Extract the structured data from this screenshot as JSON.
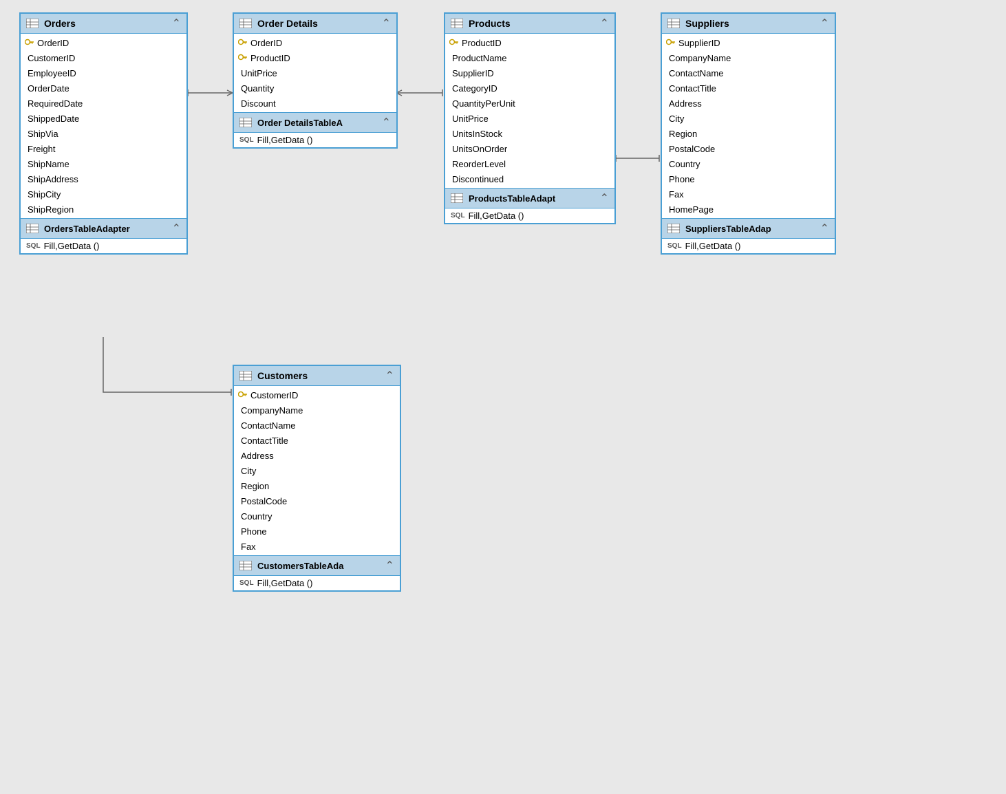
{
  "tables": {
    "orders": {
      "title": "Orders",
      "fields": [
        {
          "name": "OrderID",
          "key": true
        },
        {
          "name": "CustomerID",
          "key": false
        },
        {
          "name": "EmployeeID",
          "key": false
        },
        {
          "name": "OrderDate",
          "key": false
        },
        {
          "name": "RequiredDate",
          "key": false
        },
        {
          "name": "ShippedDate",
          "key": false
        },
        {
          "name": "ShipVia",
          "key": false
        },
        {
          "name": "Freight",
          "key": false
        },
        {
          "name": "ShipName",
          "key": false
        },
        {
          "name": "ShipAddress",
          "key": false
        },
        {
          "name": "ShipCity",
          "key": false
        },
        {
          "name": "ShipRegion",
          "key": false
        }
      ],
      "adapter": "OrdersTableAdapter",
      "method": "Fill,GetData ()"
    },
    "orderDetails": {
      "title": "Order Details",
      "fields": [
        {
          "name": "OrderID",
          "key": true
        },
        {
          "name": "ProductID",
          "key": true
        },
        {
          "name": "UnitPrice",
          "key": false
        },
        {
          "name": "Quantity",
          "key": false
        },
        {
          "name": "Discount",
          "key": false
        }
      ],
      "adapter": "Order DetailsTableA",
      "method": "Fill,GetData ()"
    },
    "products": {
      "title": "Products",
      "fields": [
        {
          "name": "ProductID",
          "key": true
        },
        {
          "name": "ProductName",
          "key": false
        },
        {
          "name": "SupplierID",
          "key": false
        },
        {
          "name": "CategoryID",
          "key": false
        },
        {
          "name": "QuantityPerUnit",
          "key": false
        },
        {
          "name": "UnitPrice",
          "key": false
        },
        {
          "name": "UnitsInStock",
          "key": false
        },
        {
          "name": "UnitsOnOrder",
          "key": false
        },
        {
          "name": "ReorderLevel",
          "key": false
        },
        {
          "name": "Discontinued",
          "key": false
        }
      ],
      "adapter": "ProductsTableAdapt",
      "method": "Fill,GetData ()"
    },
    "suppliers": {
      "title": "Suppliers",
      "fields": [
        {
          "name": "SupplierID",
          "key": true
        },
        {
          "name": "CompanyName",
          "key": false
        },
        {
          "name": "ContactName",
          "key": false
        },
        {
          "name": "ContactTitle",
          "key": false
        },
        {
          "name": "Address",
          "key": false
        },
        {
          "name": "City",
          "key": false
        },
        {
          "name": "Region",
          "key": false
        },
        {
          "name": "PostalCode",
          "key": false
        },
        {
          "name": "Country",
          "key": false
        },
        {
          "name": "Phone",
          "key": false
        },
        {
          "name": "Fax",
          "key": false
        },
        {
          "name": "HomePage",
          "key": false
        }
      ],
      "adapter": "SuppliersTableAdap",
      "method": "Fill,GetData ()"
    },
    "customers": {
      "title": "Customers",
      "fields": [
        {
          "name": "CustomerID",
          "key": true
        },
        {
          "name": "CompanyName",
          "key": false
        },
        {
          "name": "ContactName",
          "key": false
        },
        {
          "name": "ContactTitle",
          "key": false
        },
        {
          "name": "Address",
          "key": false
        },
        {
          "name": "City",
          "key": false
        },
        {
          "name": "Region",
          "key": false
        },
        {
          "name": "PostalCode",
          "key": false
        },
        {
          "name": "Country",
          "key": false
        },
        {
          "name": "Phone",
          "key": false
        },
        {
          "name": "Fax",
          "key": false
        }
      ],
      "adapter": "CustomersTableAda",
      "method": "Fill,GetData ()"
    }
  },
  "collapse_label": "⌃",
  "key_symbol": "🔑",
  "db_table_symbol": "▤"
}
